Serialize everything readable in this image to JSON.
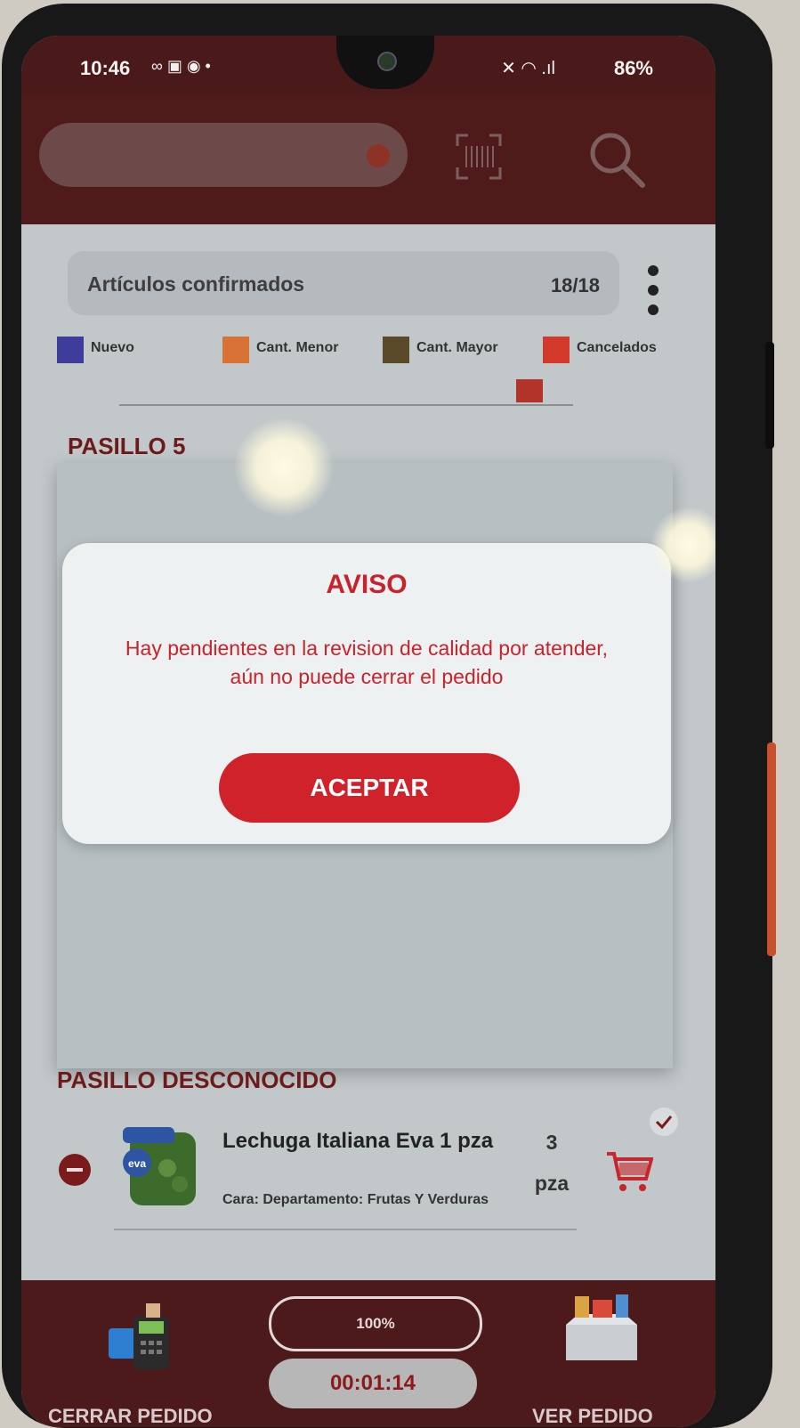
{
  "status_bar": {
    "time": "10:46",
    "icons": "∞ ▣ ◉ •",
    "signal": "✕ ◠ .ıl",
    "battery": "86%"
  },
  "header": {
    "search_icon": "magnifier-icon",
    "barcode_icon": "barcode-scan-icon"
  },
  "summary": {
    "label": "Artículos confirmados",
    "count": "18/18"
  },
  "legend": [
    {
      "label": "Nuevo",
      "color": "#3f3d9c"
    },
    {
      "label": "Cant. Menor",
      "color": "#d97335"
    },
    {
      "label": "Cant. Mayor",
      "color": "#5b4a2a"
    },
    {
      "label": "Cancelados",
      "color": "#d33a2c"
    }
  ],
  "sections": {
    "aisle": "PASILLO 5",
    "unknown": "PASILLO DESCONOCIDO"
  },
  "dialog": {
    "title": "AVISO",
    "message": "Hay pendientes en la revision de calidad por atender, aún no puede cerrar el pedido",
    "button": "ACEPTAR"
  },
  "item": {
    "name": "Lechuga Italiana  Eva 1 pza",
    "meta": "Cara:  Departamento: Frutas Y Verduras",
    "qty_value": "3",
    "qty_unit": "pza"
  },
  "footer": {
    "progress": "100%",
    "progress_value": 1.0,
    "timer": "00:01:14",
    "close_label": "CERRAR PEDIDO",
    "view_label": "VER PEDIDO"
  },
  "colors": {
    "brand_dark": "#4f1a1a",
    "accent_red": "#d0222b"
  }
}
